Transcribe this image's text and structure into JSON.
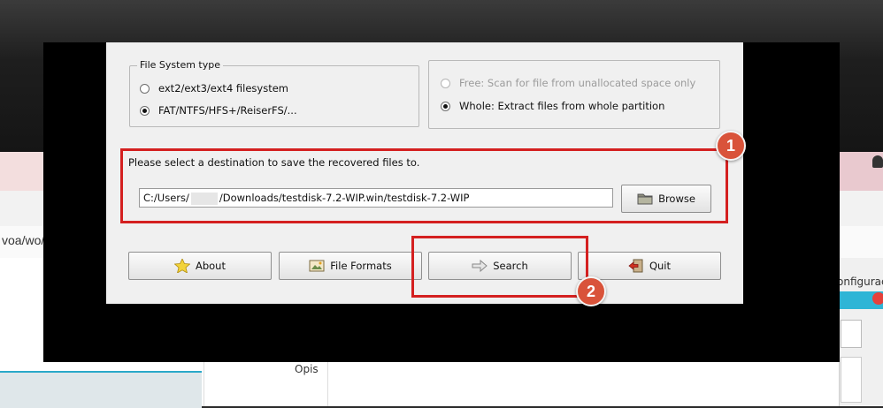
{
  "background": {
    "url_fragment": "voa/wo/",
    "right_panel_label": "onfiguraç",
    "field_label": "Opis"
  },
  "dialog": {
    "fs_group": {
      "legend": "File System type",
      "options": [
        {
          "label": "ext2/ext3/ext4 filesystem",
          "checked": false
        },
        {
          "label": "FAT/NTFS/HFS+/ReiserFS/...",
          "checked": true
        }
      ]
    },
    "scan_group": {
      "options": [
        {
          "label": "Free: Scan for file from unallocated space only",
          "checked": false,
          "disabled": true
        },
        {
          "label": "Whole: Extract files from whole partition",
          "checked": true,
          "disabled": false
        }
      ]
    },
    "destination": {
      "label": "Please select a destination to save the recovered files to.",
      "path_prefix": "C:/Users/",
      "path_suffix": "/Downloads/testdisk-7.2-WIP.win/testdisk-7.2-WIP",
      "browse_label": "Browse"
    },
    "buttons": {
      "about": "About",
      "file_formats": "File Formats",
      "search": "Search",
      "quit": "Quit"
    }
  },
  "annotations": {
    "badge_1": "1",
    "badge_2": "2",
    "color": "#d42020"
  },
  "icons": [
    "folder-icon",
    "star-icon",
    "image-icon",
    "arrow-right-icon",
    "exit-icon"
  ]
}
